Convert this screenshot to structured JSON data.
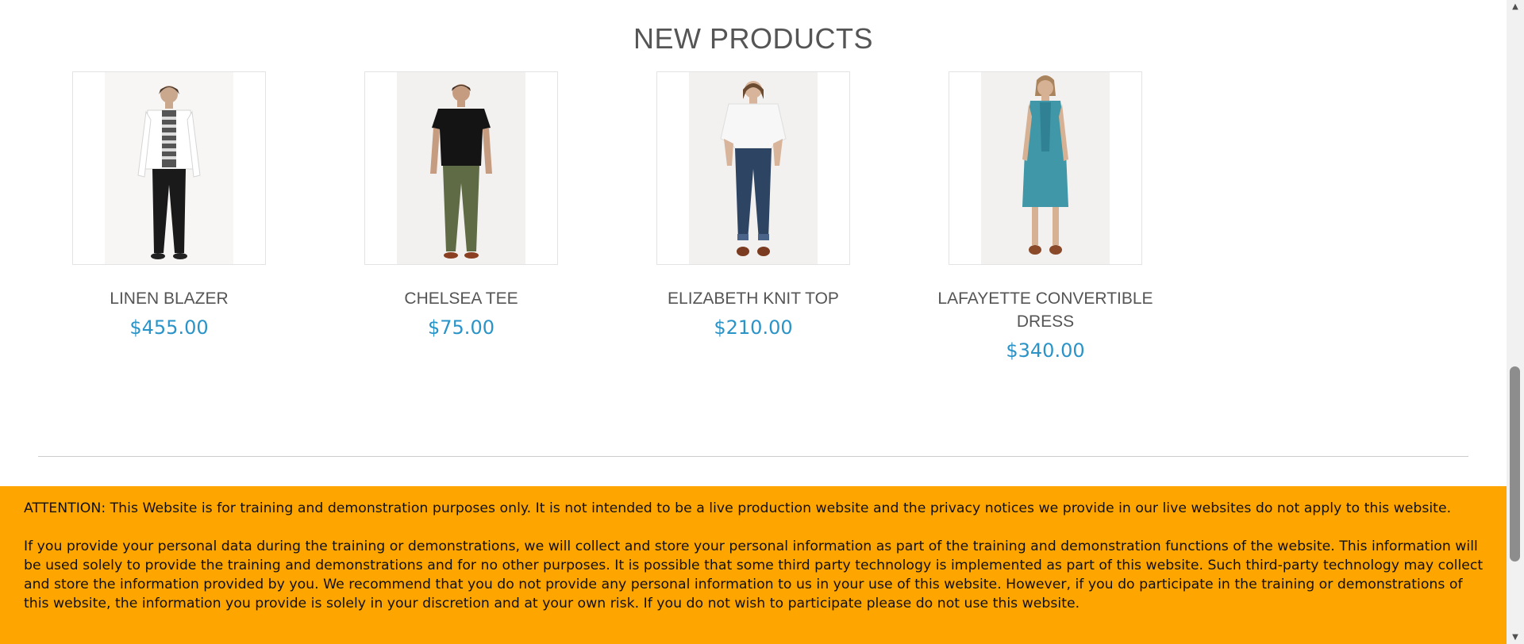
{
  "section": {
    "title": "NEW PRODUCTS"
  },
  "products": [
    {
      "name": "LINEN BLAZER",
      "price": "$455.00"
    },
    {
      "name": "CHELSEA TEE",
      "price": "$75.00"
    },
    {
      "name": "ELIZABETH KNIT TOP",
      "price": "$210.00"
    },
    {
      "name": "LAFAYETTE CONVERTIBLE DRESS",
      "price": "$340.00"
    }
  ],
  "notice": {
    "paragraph1": "ATTENTION: This Website is for training and demonstration purposes only. It is not intended to be a live production website and the privacy notices we provide in our live websites do not apply to this website.",
    "paragraph2": "If you provide your personal data during the training or demonstrations, we will collect and store your personal information as part of the training and demonstration functions of the website. This information will be used solely to provide the training and demonstrations and for no other purposes. It is possible that some third party technology is implemented as part of this website. Such third-party technology may collect and store the information provided by you. We recommend that you do not provide any personal information to us in your use of this website. However, if you do participate in the training or demonstrations of this website, the information you provide is solely in your discretion and at your own risk. If you do not wish to participate please do not use this website.",
    "background_color": "#ffa500"
  },
  "colors": {
    "price": "#2a94c8",
    "title": "#555555"
  }
}
